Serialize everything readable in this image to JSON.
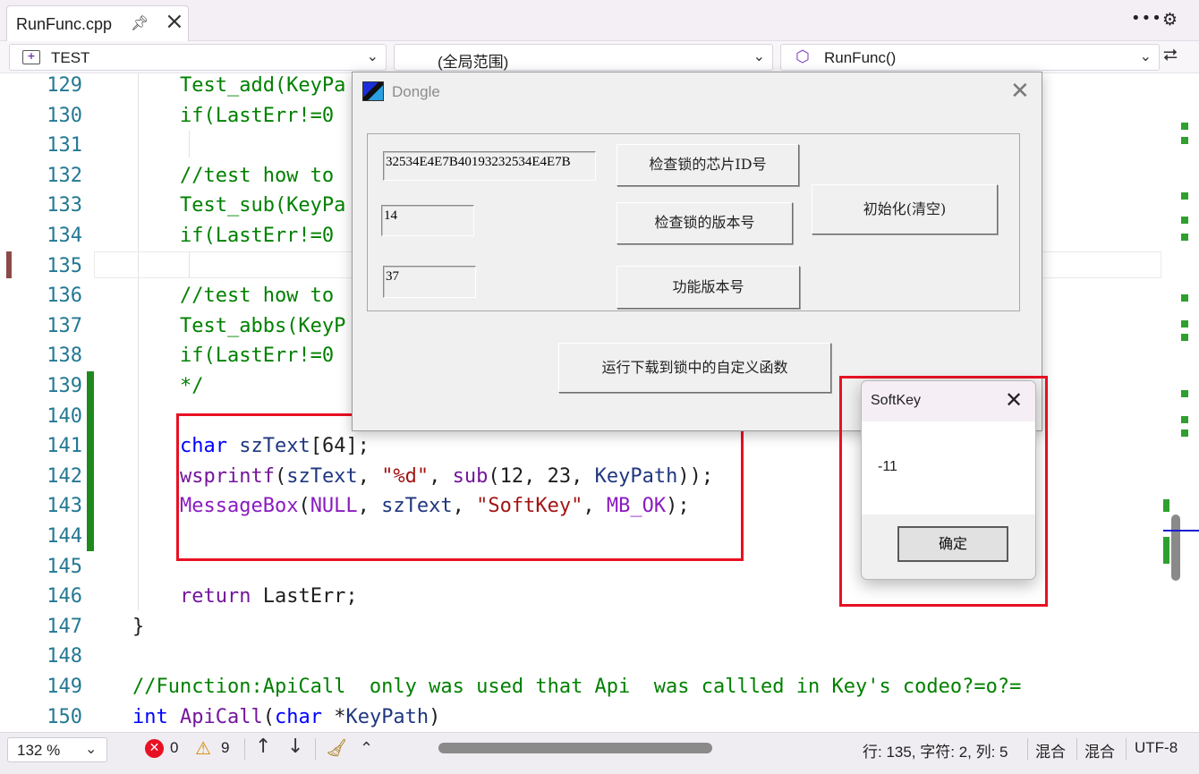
{
  "tab": {
    "title": "RunFunc.cpp",
    "pin_icon": "pin-icon",
    "close_icon": "close-icon"
  },
  "navbar": {
    "project": "TEST",
    "scope": "(全局范围)",
    "function": "RunFunc()"
  },
  "editor": {
    "current_line": "135"
  },
  "code_lines": [
    {
      "n": "129",
      "tokens": [
        {
          "t": "    Test_add(KeyPa",
          "c": "cm"
        }
      ]
    },
    {
      "n": "130",
      "tokens": [
        {
          "t": "    if(LastErr!=0",
          "c": "cm"
        }
      ]
    },
    {
      "n": "131",
      "tokens": []
    },
    {
      "n": "132",
      "tokens": [
        {
          "t": "    //test how to",
          "c": "cm"
        }
      ]
    },
    {
      "n": "133",
      "tokens": [
        {
          "t": "    Test_sub(KeyPa",
          "c": "cm"
        }
      ]
    },
    {
      "n": "134",
      "tokens": [
        {
          "t": "    if(LastErr!=0",
          "c": "cm"
        }
      ]
    },
    {
      "n": "135",
      "tokens": []
    },
    {
      "n": "136",
      "tokens": [
        {
          "t": "    //test how to",
          "c": "cm"
        }
      ]
    },
    {
      "n": "137",
      "tokens": [
        {
          "t": "    Test_abbs(KeyP",
          "c": "cm"
        }
      ]
    },
    {
      "n": "138",
      "tokens": [
        {
          "t": "    if(LastErr!=0",
          "c": "cm"
        }
      ]
    },
    {
      "n": "139",
      "tokens": [
        {
          "t": "    */",
          "c": "cm"
        }
      ]
    },
    {
      "n": "140",
      "tokens": []
    },
    {
      "n": "141",
      "tokens": [
        {
          "t": "    ",
          "c": ""
        },
        {
          "t": "char",
          "c": "kw"
        },
        {
          "t": " ",
          "c": ""
        },
        {
          "t": "szText",
          "c": "id"
        },
        {
          "t": "[64];",
          "c": ""
        }
      ]
    },
    {
      "n": "142",
      "tokens": [
        {
          "t": "    ",
          "c": ""
        },
        {
          "t": "wsprintf",
          "c": "fn"
        },
        {
          "t": "(",
          "c": ""
        },
        {
          "t": "szText",
          "c": "id"
        },
        {
          "t": ", ",
          "c": ""
        },
        {
          "t": "\"%d\"",
          "c": "str"
        },
        {
          "t": ", ",
          "c": ""
        },
        {
          "t": "sub",
          "c": "fn"
        },
        {
          "t": "(12, 23, ",
          "c": ""
        },
        {
          "t": "KeyPath",
          "c": "id"
        },
        {
          "t": "));",
          "c": ""
        }
      ]
    },
    {
      "n": "143",
      "tokens": [
        {
          "t": "    ",
          "c": ""
        },
        {
          "t": "MessageBox",
          "c": "macro"
        },
        {
          "t": "(",
          "c": ""
        },
        {
          "t": "NULL",
          "c": "macro"
        },
        {
          "t": ", ",
          "c": ""
        },
        {
          "t": "szText",
          "c": "id"
        },
        {
          "t": ", ",
          "c": ""
        },
        {
          "t": "\"SoftKey\"",
          "c": "str"
        },
        {
          "t": ", ",
          "c": ""
        },
        {
          "t": "MB_OK",
          "c": "macro"
        },
        {
          "t": ");",
          "c": ""
        }
      ]
    },
    {
      "n": "144",
      "tokens": []
    },
    {
      "n": "145",
      "tokens": []
    },
    {
      "n": "146",
      "tokens": [
        {
          "t": "    ",
          "c": ""
        },
        {
          "t": "return",
          "c": "fn"
        },
        {
          "t": " LastErr;",
          "c": ""
        }
      ]
    },
    {
      "n": "147",
      "tokens": [
        {
          "t": "}",
          "c": ""
        }
      ]
    },
    {
      "n": "148",
      "tokens": []
    },
    {
      "n": "149",
      "tokens": [
        {
          "t": "//Function:ApiCall  only was used that Api  was callled in Key's codeo?=o?=",
          "c": "cm"
        }
      ]
    },
    {
      "n": "150",
      "tokens": [
        {
          "t": "int",
          "c": "kw"
        },
        {
          "t": " ",
          "c": ""
        },
        {
          "t": "ApiCall",
          "c": "fn"
        },
        {
          "t": "(",
          "c": ""
        },
        {
          "t": "char",
          "c": "kw"
        },
        {
          "t": " *",
          "c": ""
        },
        {
          "t": "KeyPath",
          "c": "id"
        },
        {
          "t": ")",
          "c": ""
        }
      ]
    }
  ],
  "dongle": {
    "title": "Dongle",
    "chip_id": "32534E4E7B40193232534E4E7B",
    "version": "14",
    "func_version": "37",
    "btn_check_chip": "检查锁的芯片ID号",
    "btn_check_version": "检查锁的版本号",
    "btn_func_version": "功能版本号",
    "btn_init": "初始化(清空)",
    "btn_run": "运行下载到锁中的自定义函数"
  },
  "msgbox": {
    "title": "SoftKey",
    "text": "-11",
    "ok": "确定"
  },
  "status": {
    "zoom": "132 %",
    "errors": "0",
    "warnings": "9",
    "position": "行: 135, 字符: 2, 列: 5",
    "whitespace": "混合",
    "line_endings": "混合",
    "encoding": "UTF-8"
  },
  "colors": {
    "highlight_box": "#e81123",
    "comment": "#008000",
    "keyword": "#0000ff",
    "change_bar": "#1e8a1e"
  }
}
